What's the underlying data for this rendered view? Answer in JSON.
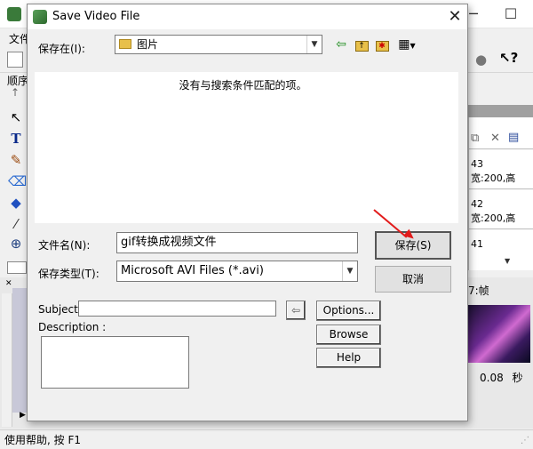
{
  "dialog": {
    "title": "Save Video File",
    "save_in_label": "保存在(I):",
    "save_in_value": "图片",
    "empty_message": "没有与搜索条件匹配的项。",
    "filename_label": "文件名(N):",
    "filename_value": "gif转换成视频文件",
    "filetype_label": "保存类型(T):",
    "filetype_value": "Microsoft AVI Files (*.avi)",
    "save_button": "保存(S)",
    "cancel_button": "取消",
    "subject_label": "Subject:",
    "subject_value": "",
    "description_label": "Description :",
    "description_value": "",
    "options_button": "Options...",
    "browse_button": "Browse",
    "help_button": "Help",
    "icons": [
      "back-arrow-icon",
      "up-folder-icon",
      "new-folder-icon",
      "view-menu-icon",
      "arrow-left-icon"
    ]
  },
  "background": {
    "menu_label": "文件",
    "side_label": "顺序",
    "right_panel_rows": [
      {
        "num": "43",
        "detail": "宽:200,高"
      },
      {
        "num": "42",
        "detail": "宽:200,高"
      },
      {
        "num": "41",
        "detail": ""
      }
    ],
    "frame_label": "7:帧",
    "time_value": "0.08",
    "time_unit": "秒",
    "status_text": "使用帮助, 按 F1"
  },
  "colors": {
    "annotation_arrow": "#e21b1b",
    "folder": "#e8c04a"
  }
}
